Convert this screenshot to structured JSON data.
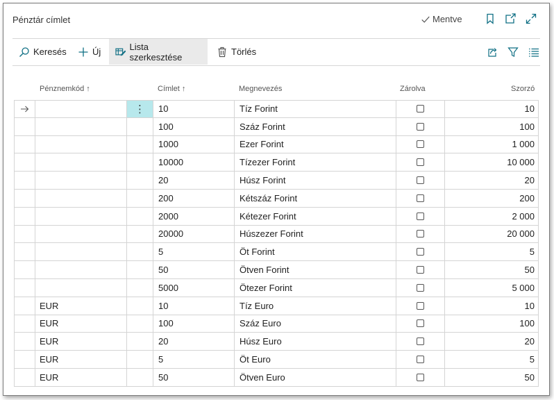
{
  "window": {
    "title": "Pénztár címlet",
    "saved_label": "Mentve"
  },
  "icons": {
    "check": "check-icon",
    "bookmark": "bookmark-icon",
    "popout": "open-in-new-window-icon",
    "expand": "expand-icon",
    "search": "search-icon",
    "add": "plus-icon",
    "edit_list": "edit-list-icon",
    "delete": "trash-icon",
    "share": "share-icon",
    "filter": "filter-icon",
    "list_view": "list-view-icon",
    "row_marker": "arrow-right-icon",
    "row_menu": "vertical-ellipsis-icon"
  },
  "actions": {
    "search": "Keresés",
    "new": "Új",
    "edit_list": "Lista szerkesztése",
    "delete": "Törlés"
  },
  "columns": {
    "currency_code": "Pénznemkód",
    "denomination": "Címlet",
    "description": "Megnevezés",
    "locked": "Zárolva",
    "multiplier": "Szorzó"
  },
  "rows": [
    {
      "code": "",
      "denom": "10",
      "desc": "Tíz Forint",
      "locked": false,
      "mult": "10",
      "selected": true
    },
    {
      "code": "",
      "denom": "100",
      "desc": "Száz Forint",
      "locked": false,
      "mult": "100"
    },
    {
      "code": "",
      "denom": "1000",
      "desc": "Ezer Forint",
      "locked": false,
      "mult": "1 000"
    },
    {
      "code": "",
      "denom": "10000",
      "desc": "Tízezer Forint",
      "locked": false,
      "mult": "10 000"
    },
    {
      "code": "",
      "denom": "20",
      "desc": "Húsz Forint",
      "locked": false,
      "mult": "20"
    },
    {
      "code": "",
      "denom": "200",
      "desc": "Kétszáz Forint",
      "locked": false,
      "mult": "200"
    },
    {
      "code": "",
      "denom": "2000",
      "desc": "Kétezer Forint",
      "locked": false,
      "mult": "2 000"
    },
    {
      "code": "",
      "denom": "20000",
      "desc": "Húszezer Forint",
      "locked": false,
      "mult": "20 000"
    },
    {
      "code": "",
      "denom": "5",
      "desc": "Öt Forint",
      "locked": false,
      "mult": "5"
    },
    {
      "code": "",
      "denom": "50",
      "desc": "Ötven Forint",
      "locked": false,
      "mult": "50"
    },
    {
      "code": "",
      "denom": "5000",
      "desc": "Ötezer Forint",
      "locked": false,
      "mult": "5 000"
    },
    {
      "code": "EUR",
      "denom": "10",
      "desc": "Tíz Euro",
      "locked": false,
      "mult": "10"
    },
    {
      "code": "EUR",
      "denom": "100",
      "desc": "Száz Euro",
      "locked": false,
      "mult": "100"
    },
    {
      "code": "EUR",
      "denom": "20",
      "desc": "Húsz Euro",
      "locked": false,
      "mult": "20"
    },
    {
      "code": "EUR",
      "denom": "5",
      "desc": "Öt Euro",
      "locked": false,
      "mult": "5"
    },
    {
      "code": "EUR",
      "denom": "50",
      "desc": "Ötven Euro",
      "locked": false,
      "mult": "50"
    }
  ],
  "colors": {
    "accent": "#0f6f84",
    "selected_cell": "#b7e8ec",
    "active_action": "#eaeaea"
  }
}
